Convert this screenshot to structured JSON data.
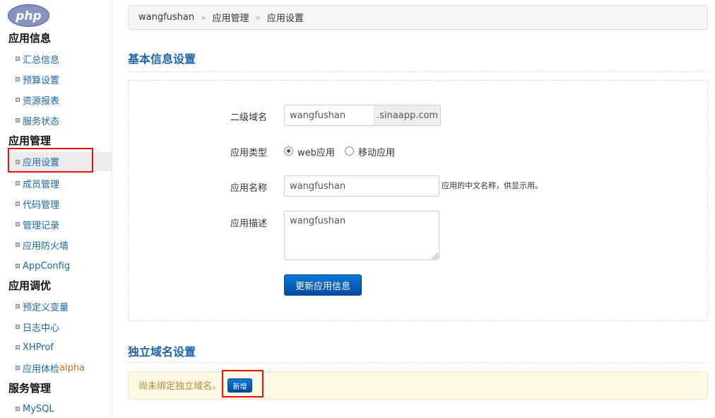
{
  "logo": {
    "text": "php"
  },
  "sidebar": {
    "groups": [
      {
        "title": "应用信息",
        "items": [
          "汇总信息",
          "预算设置",
          "资源报表",
          "服务状态"
        ]
      },
      {
        "title": "应用管理",
        "items": [
          "应用设置",
          "成员管理",
          "代码管理",
          "管理记录",
          "应用防火墙",
          "AppConfig"
        ]
      },
      {
        "title": "应用调优",
        "items": [
          "预定义变量",
          "日志中心",
          "XHProf",
          "应用体检"
        ]
      },
      {
        "title": "服务管理",
        "items": [
          "MySQL"
        ]
      }
    ],
    "badge_alpha": "alpha",
    "active_item": "应用设置"
  },
  "breadcrumb": [
    "wangfushan",
    "应用管理",
    "应用设置"
  ],
  "breadcrumb_sep": "»",
  "basic_section": {
    "title": "基本信息设置",
    "subdomain": {
      "label": "二级域名",
      "value": "wangfushan",
      "suffix": ".sinaapp.com"
    },
    "app_type": {
      "label": "应用类型",
      "options": [
        "web应用",
        "移动应用"
      ],
      "selected": "web应用"
    },
    "app_name": {
      "label": "应用名称",
      "value": "wangfushan",
      "hint": "应用的中文名称，供显示用。"
    },
    "app_desc": {
      "label": "应用描述",
      "value": "wangfushan"
    },
    "submit_label": "更新应用信息"
  },
  "domain_section": {
    "title": "独立域名设置",
    "empty_text": "尚未绑定独立域名。",
    "add_label": "新增"
  },
  "colors": {
    "link": "#1a66a8",
    "heading": "#1e64a8",
    "button": "#0549a3",
    "highlight": "#e11111",
    "alpha": "#e06a1a"
  }
}
